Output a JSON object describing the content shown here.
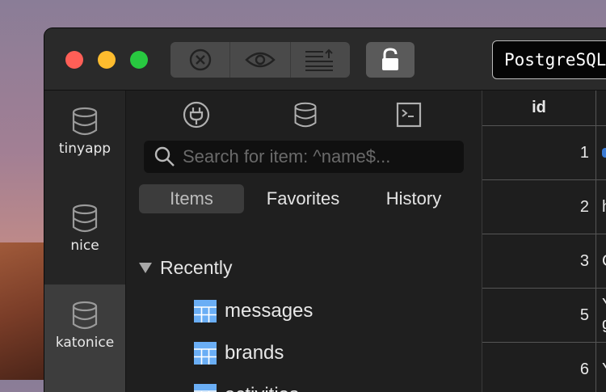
{
  "toolbar": {
    "connection_name": "PostgreSQL",
    "traffic_colors": {
      "close": "#ff5f57",
      "minimize": "#febc2e",
      "zoom": "#28c840"
    },
    "buttons": [
      {
        "icon": "close-circle-icon"
      },
      {
        "icon": "eye-icon"
      },
      {
        "icon": "list-upload-icon"
      }
    ],
    "lock_icon": "lock-icon"
  },
  "connections": [
    {
      "label": "tinyapp",
      "icon": "database-icon",
      "active": false
    },
    {
      "label": "nice",
      "icon": "database-icon",
      "active": false
    },
    {
      "label": "katonice",
      "icon": "database-icon",
      "active": true
    }
  ],
  "panel": {
    "tools": [
      {
        "icon": "plug-icon"
      },
      {
        "icon": "database-icon"
      },
      {
        "icon": "terminal-icon"
      }
    ],
    "search_placeholder": "Search for item: ^name$...",
    "tabs": [
      {
        "label": "Items",
        "selected": true
      },
      {
        "label": "Favorites",
        "selected": false
      },
      {
        "label": "History",
        "selected": false
      }
    ],
    "section_label": "Recently",
    "tables": [
      "messages",
      "brands",
      "activities"
    ]
  },
  "grid": {
    "column": "id",
    "rows": [
      {
        "id": "1",
        "next": ""
      },
      {
        "id": "2",
        "next": "h"
      },
      {
        "id": "3",
        "next": "C"
      },
      {
        "id": "5",
        "next": "Y\ng"
      },
      {
        "id": "6",
        "next": "Y"
      }
    ]
  }
}
